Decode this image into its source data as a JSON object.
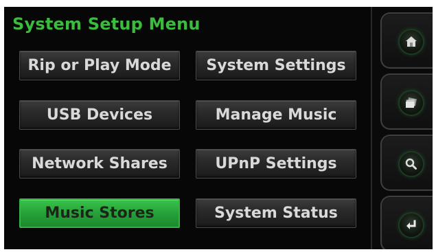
{
  "title": "System Setup Menu",
  "menu": {
    "rip_or_play_mode": "Rip or Play Mode",
    "system_settings": "System Settings",
    "usb_devices": "USB Devices",
    "manage_music": "Manage Music",
    "network_shares": "Network Shares",
    "upnp_settings": "UPnP Settings",
    "music_stores": "Music Stores",
    "system_status": "System Status",
    "selected": "Music Stores"
  },
  "side_buttons": {
    "icons": [
      "home-icon",
      "albums-icon",
      "search-icon",
      "return-icon"
    ]
  },
  "colors": {
    "title_green": "#3cbc3e",
    "selected_green": "#2aa83c",
    "button_text": "#d9d9d9",
    "background": "#070707"
  }
}
